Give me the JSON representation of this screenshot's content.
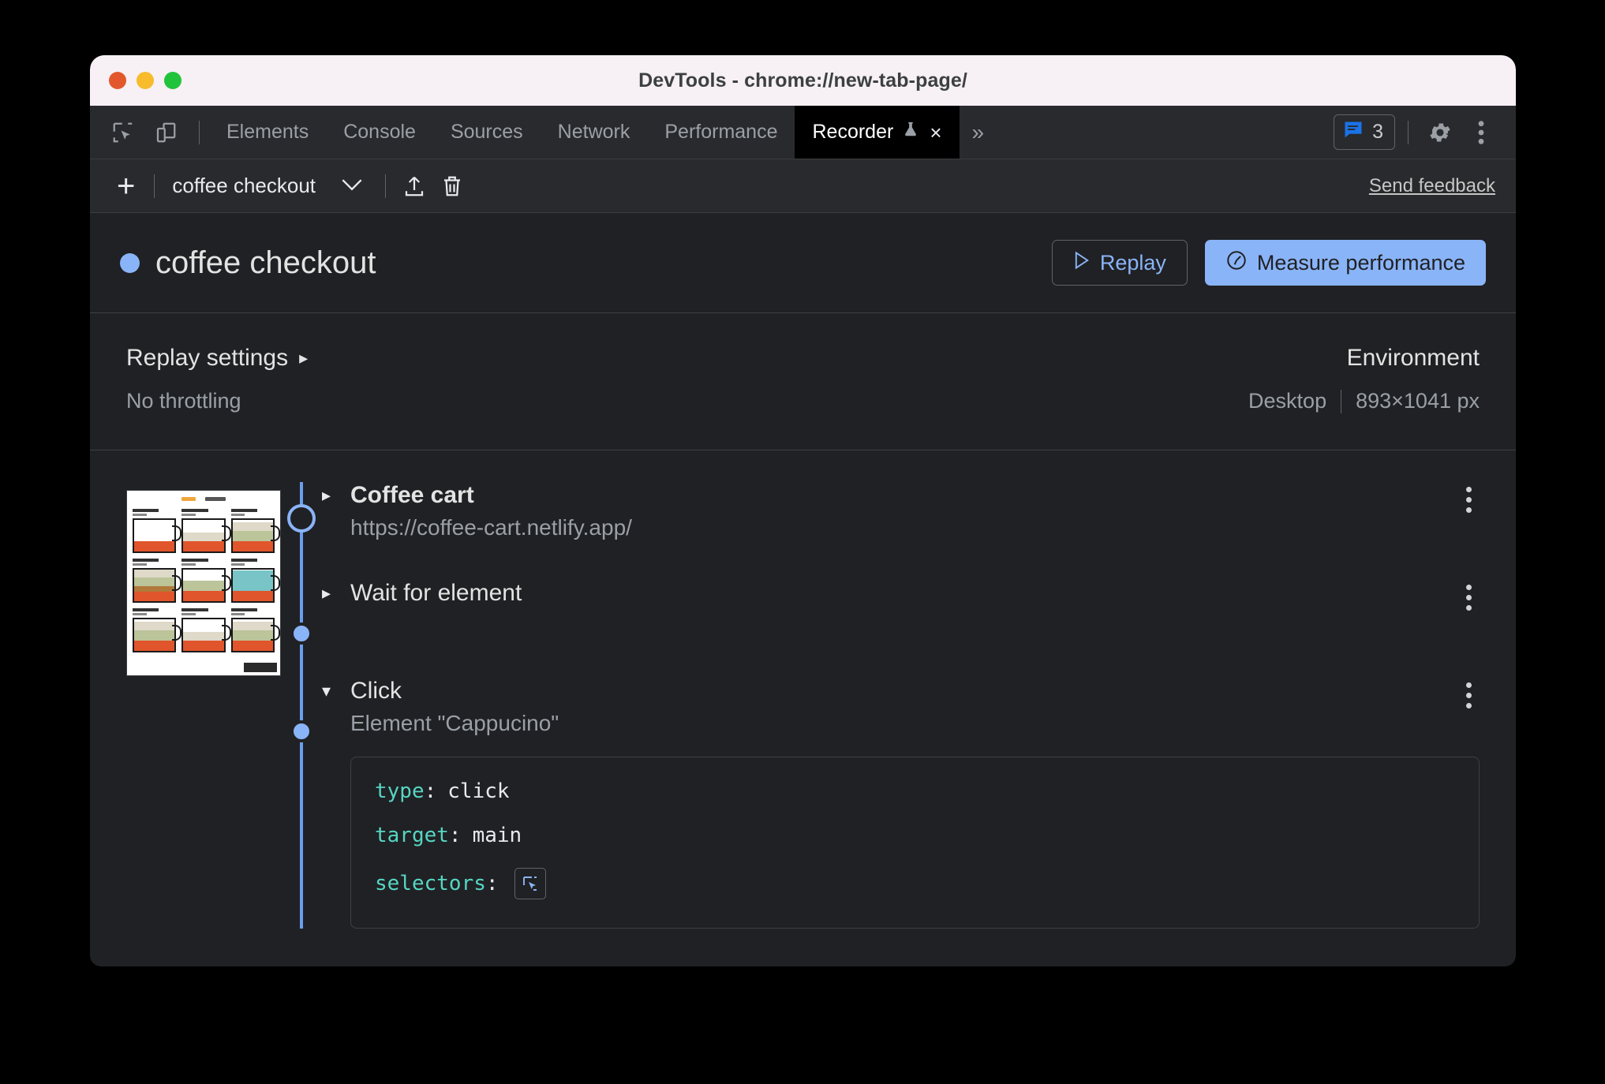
{
  "window": {
    "title": "DevTools - chrome://new-tab-page/",
    "traffic_lights": [
      "close-red",
      "minimize-yellow",
      "zoom-green"
    ]
  },
  "tabbar": {
    "inspect_icon": "inspect-element-icon",
    "device_icon": "device-toolbar-icon",
    "tabs": [
      {
        "label": "Elements",
        "active": false
      },
      {
        "label": "Console",
        "active": false
      },
      {
        "label": "Sources",
        "active": false
      },
      {
        "label": "Network",
        "active": false
      },
      {
        "label": "Performance",
        "active": false
      },
      {
        "label": "Recorder",
        "active": true,
        "experiment_icon": "flask-icon",
        "close": "×"
      }
    ],
    "more_tabs": "»",
    "messages": {
      "icon": "message-icon",
      "count": "3",
      "color": "#1a73e8"
    },
    "settings_icon": "gear-icon",
    "main_menu_icon": "three-dot-vertical-icon"
  },
  "recorder_toolbar": {
    "add_label": "+",
    "recording_name": "coffee checkout",
    "dropdown_chevron": "⌄",
    "export_icon": "export-upload-icon",
    "delete_icon": "trash-icon",
    "feedback_label": "Send feedback"
  },
  "header": {
    "status_dot_color": "#8ab4f8",
    "title": "coffee checkout",
    "replay_button": {
      "label": "Replay",
      "icon": "play-triangle-icon"
    },
    "measure_button": {
      "label": "Measure performance",
      "icon": "speedometer-icon",
      "bg": "#8ab4f8"
    }
  },
  "settings": {
    "replay": {
      "title": "Replay settings",
      "arrow": "▸",
      "value": "No throttling"
    },
    "environment": {
      "title": "Environment",
      "device": "Desktop",
      "viewport": "893×1041 px"
    }
  },
  "steps": {
    "screenshot_alt": "coffee-cart-page-thumbnail",
    "items": [
      {
        "name": "Coffee cart",
        "sub": "https://coffee-cart.netlify.app/",
        "expanded": false,
        "arrow": "▸",
        "bold": true,
        "node": "first"
      },
      {
        "name": "Wait for element",
        "sub": "",
        "expanded": false,
        "arrow": "▸",
        "bold": false,
        "node": "dot"
      },
      {
        "name": "Click",
        "sub": "Element \"Cappucino\"",
        "expanded": true,
        "arrow": "▾",
        "bold": false,
        "node": "dot"
      }
    ],
    "code": {
      "lines": [
        {
          "key": "type",
          "colon": ":",
          "value": "click"
        },
        {
          "key": "target",
          "colon": ":",
          "value": "main"
        },
        {
          "key": "selectors",
          "colon": ":",
          "value": "",
          "picker_icon": "selector-picker-icon"
        }
      ]
    },
    "kebab_icon": "three-dot-vertical-icon"
  }
}
